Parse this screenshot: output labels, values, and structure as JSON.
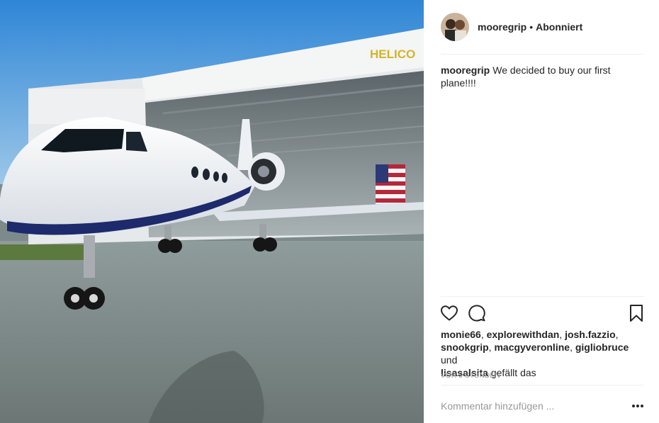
{
  "post": {
    "username": "mooregrip",
    "separator": "•",
    "follow_status": "Abonniert",
    "caption": "We decided to buy our first plane!!!!",
    "hangar_sign": "HELICO",
    "likes": {
      "likers": [
        "monie66",
        "explorewithdan",
        "josh.fazzio",
        "snookgrip",
        "macgyveronline",
        "gigliobruce"
      ],
      "conjunction": "und",
      "last_liker": "lisasalsita",
      "suffix": "gefällt das"
    },
    "timestamp": "VOR 5 STUNDEN",
    "comment_placeholder": "Kommentar hinzufügen ..."
  },
  "icons": {
    "like": "heart-icon",
    "comment": "comment-icon",
    "save": "bookmark-icon",
    "options": "more-options-icon"
  },
  "colors": {
    "text": "#262626",
    "muted": "#999999",
    "divider": "#efefef",
    "sky": "#4a9ad8",
    "jet_stripe": "#1d2a6b"
  }
}
